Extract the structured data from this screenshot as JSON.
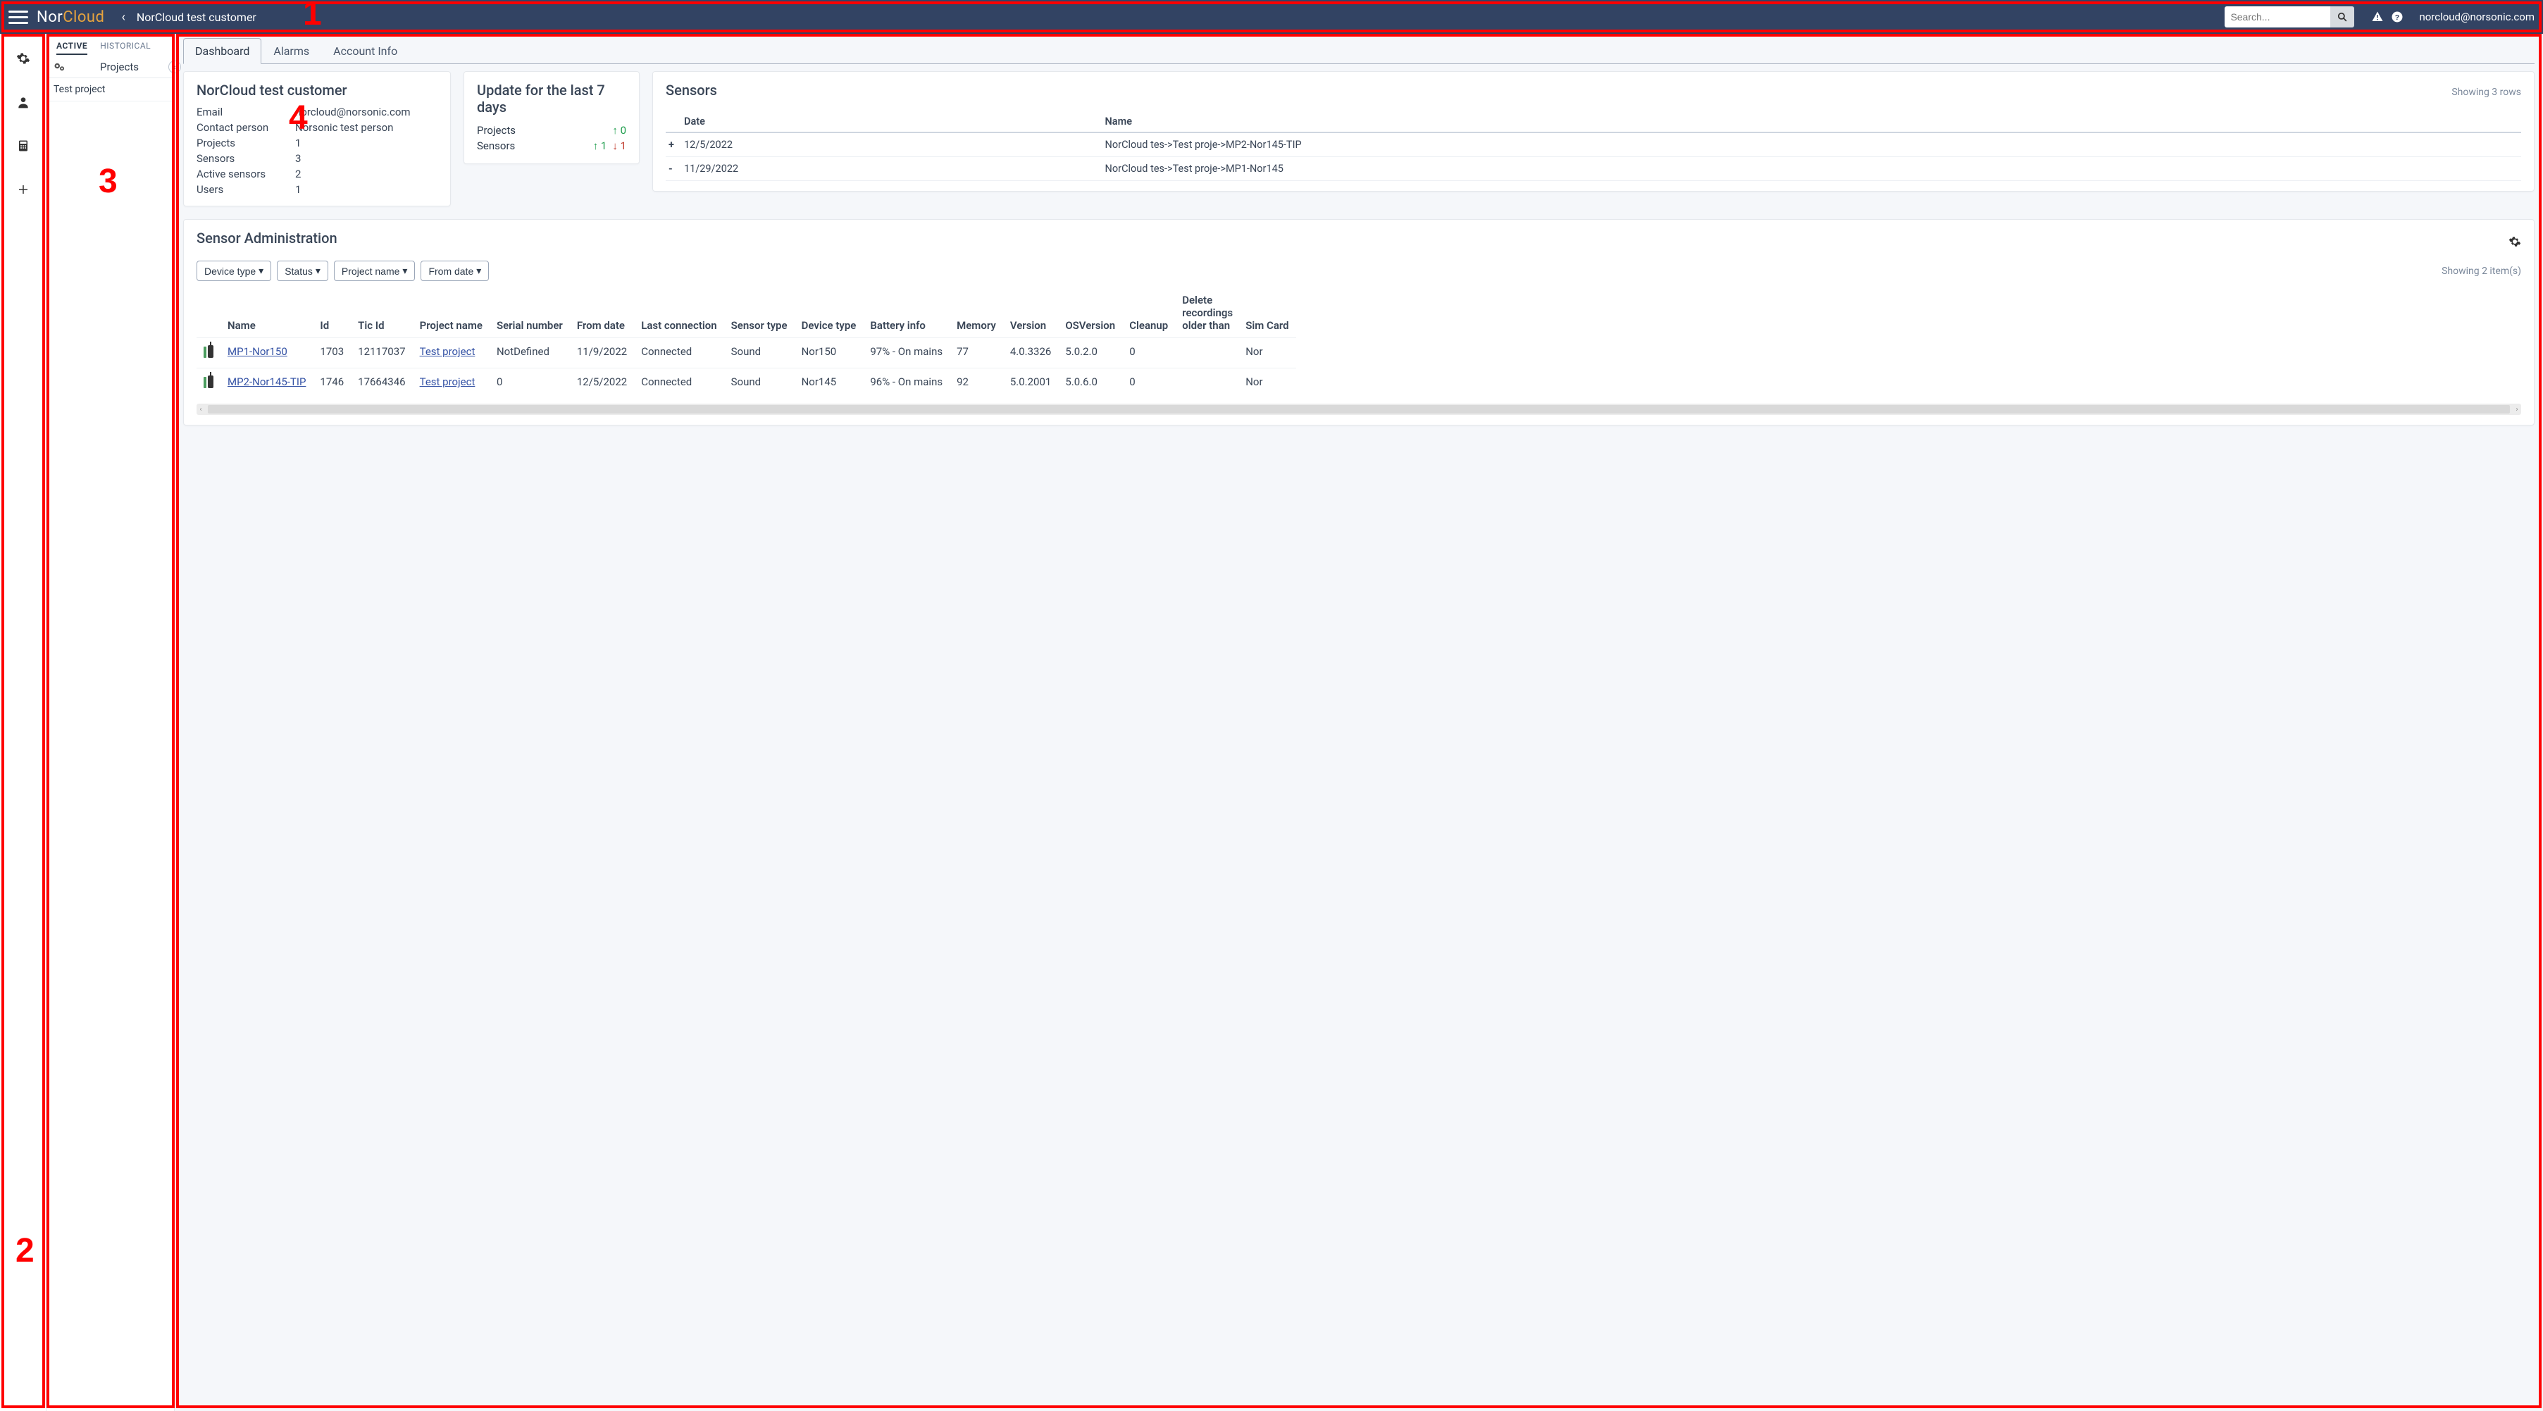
{
  "annotations": {
    "1": "1",
    "2": "2",
    "3": "3",
    "4": "4"
  },
  "header": {
    "brand_nor": "Nor",
    "brand_cloud": "Cloud",
    "breadcrumb": "NorCloud test customer",
    "search_placeholder": "Search...",
    "user_email": "norcloud@norsonic.com"
  },
  "sidebar": {
    "tabs": {
      "active": "ACTIVE",
      "historical": "HISTORICAL"
    },
    "section_label": "Projects",
    "items": [
      {
        "label": "Test project"
      }
    ]
  },
  "main_tabs": {
    "dashboard": "Dashboard",
    "alarms": "Alarms",
    "account_info": "Account Info"
  },
  "customer_card": {
    "title": "NorCloud test customer",
    "rows": {
      "email_label": "Email",
      "email_value": "norcloud@norsonic.com",
      "contact_label": "Contact person",
      "contact_value": "Norsonic test person",
      "projects_label": "Projects",
      "projects_value": "1",
      "sensors_label": "Sensors",
      "sensors_value": "3",
      "active_sensors_label": "Active sensors",
      "active_sensors_value": "2",
      "users_label": "Users",
      "users_value": "1"
    }
  },
  "update_card": {
    "title": "Update for the last 7 days",
    "projects_label": "Projects",
    "projects_up": "0",
    "sensors_label": "Sensors",
    "sensors_up": "1",
    "sensors_down": "1"
  },
  "sensors_card": {
    "title": "Sensors",
    "showing": "Showing 3 rows",
    "cols": {
      "date": "Date",
      "name": "Name"
    },
    "rows": [
      {
        "sign": "+",
        "date": "12/5/2022",
        "name": "NorCloud tes->Test proje->MP2-Nor145-TIP"
      },
      {
        "sign": "-",
        "date": "11/29/2022",
        "name": "NorCloud tes->Test proje->MP1-Nor145"
      }
    ]
  },
  "admin": {
    "title": "Sensor Administration",
    "filters": {
      "device_type": "Device type",
      "status": "Status",
      "project_name": "Project name",
      "from_date": "From date"
    },
    "showing": "Showing 2 item(s)",
    "cols": {
      "name": "Name",
      "id": "Id",
      "ticid": "Tic Id",
      "project": "Project name",
      "serial": "Serial number",
      "from": "From date",
      "lastconn": "Last connection",
      "stype": "Sensor type",
      "dtype": "Device type",
      "battery": "Battery info",
      "memory": "Memory",
      "version": "Version",
      "osversion": "OSVersion",
      "cleanup": "Cleanup",
      "delete": "Delete recordings older than",
      "sim": "Sim Card"
    },
    "rows": [
      {
        "name": "MP1-Nor150",
        "id": "1703",
        "ticid": "12117037",
        "project": "Test project",
        "serial": "NotDefined",
        "from": "11/9/2022",
        "lastconn": "Connected",
        "stype": "Sound",
        "dtype": "Nor150",
        "battery": "97% - On mains",
        "memory": "77",
        "version": "4.0.3326",
        "osversion": "5.0.2.0",
        "cleanup": "0",
        "delete": "",
        "sim": "Nor"
      },
      {
        "name": "MP2-Nor145-TIP",
        "id": "1746",
        "ticid": "17664346",
        "project": "Test project",
        "serial": "0",
        "from": "12/5/2022",
        "lastconn": "Connected",
        "stype": "Sound",
        "dtype": "Nor145",
        "battery": "96% - On mains",
        "memory": "92",
        "version": "5.0.2001",
        "osversion": "5.0.6.0",
        "cleanup": "0",
        "delete": "",
        "sim": "Nor"
      }
    ]
  }
}
